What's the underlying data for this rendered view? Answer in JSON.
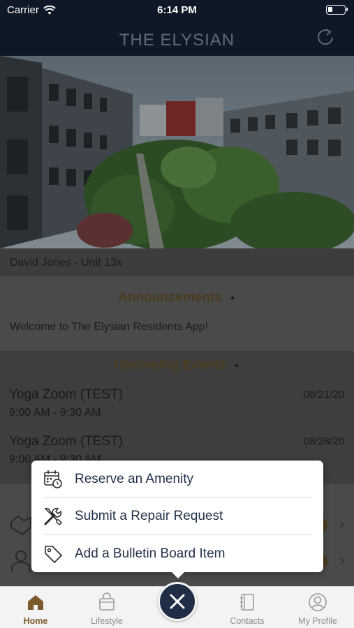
{
  "status_bar": {
    "carrier": "Carrier",
    "time": "6:14 PM"
  },
  "header": {
    "title": "THE ELYSIAN"
  },
  "user": {
    "line": "David Jones - Unit 13x"
  },
  "announcements": {
    "heading": "Announcements",
    "text": "Welcome to The Elysian Residents App!"
  },
  "events": {
    "heading": "Upcoming Events",
    "items": [
      {
        "title": "Yoga Zoom (TEST)",
        "time": "9:00 AM - 9:30 AM",
        "date": "08/21/20"
      },
      {
        "title": "Yoga Zoom (TEST)",
        "time": "9:00 AM - 9:30 AM",
        "date": "08/28/20"
      }
    ]
  },
  "menu": {
    "items": [
      {
        "label": "Reserve an Amenity",
        "icon": "calendar-clock-icon"
      },
      {
        "label": "Submit a Repair Request",
        "icon": "tools-icon"
      },
      {
        "label": "Add a Bulletin Board Item",
        "icon": "tag-icon"
      }
    ]
  },
  "tabs": [
    {
      "label": "Home",
      "icon": "home-icon",
      "active": true
    },
    {
      "label": "Lifestyle",
      "icon": "shopping-bag-icon",
      "active": false
    },
    {
      "label": "Contacts",
      "icon": "contacts-book-icon",
      "active": false
    },
    {
      "label": "My Profile",
      "icon": "profile-icon",
      "active": false
    }
  ],
  "colors": {
    "navy": "#1f2d45",
    "gold": "#7a5a2a",
    "header_bg": "#0f1826"
  }
}
